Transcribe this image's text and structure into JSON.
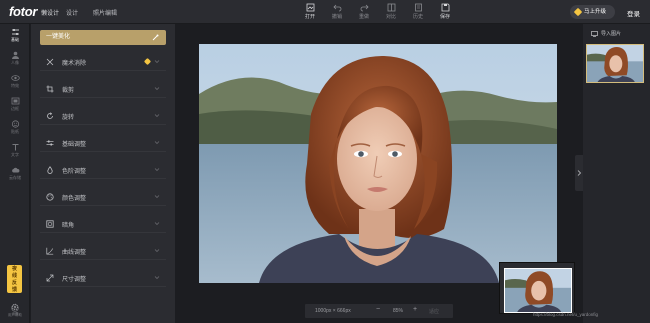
{
  "header": {
    "brand": "fotor",
    "brand_sub": "懒设计",
    "nav": [
      "设计",
      "照片编辑"
    ],
    "tools": [
      {
        "label": "打开",
        "icon": "open-file-icon",
        "active": true
      },
      {
        "label": "撤销",
        "icon": "undo-icon",
        "active": false
      },
      {
        "label": "重做",
        "icon": "redo-icon",
        "active": false
      },
      {
        "label": "对比",
        "icon": "compare-icon",
        "active": false
      },
      {
        "label": "历史",
        "icon": "history-icon",
        "active": false
      },
      {
        "label": "保存",
        "icon": "save-icon",
        "active": true
      }
    ],
    "upgrade_label": "马上升级",
    "login_label": "登录"
  },
  "rail": {
    "items": [
      {
        "label": "基础",
        "icon": "sliders-icon",
        "active": true
      },
      {
        "label": "人像",
        "icon": "person-icon",
        "active": false
      },
      {
        "label": "特效",
        "icon": "eye-icon",
        "active": false
      },
      {
        "label": "边框",
        "icon": "frame-icon",
        "active": false
      },
      {
        "label": "贴纸",
        "icon": "sticker-icon",
        "active": false
      },
      {
        "label": "文字",
        "icon": "text-icon",
        "active": false
      },
      {
        "label": "云存储",
        "icon": "cloud-icon",
        "active": false
      }
    ],
    "badge": "夜\n线\n反\n馈",
    "help_label": "用户帮助",
    "settings_label": "设置"
  },
  "panel": {
    "oneclick_label": "一键美化",
    "items": [
      {
        "label": "魔术消除",
        "icon": "eraser-icon",
        "pro": true
      },
      {
        "label": "裁剪",
        "icon": "crop-icon",
        "pro": false
      },
      {
        "label": "旋转",
        "icon": "rotate-icon",
        "pro": false
      },
      {
        "label": "基础调整",
        "icon": "adjust-icon",
        "pro": false
      },
      {
        "label": "色阶调整",
        "icon": "droplet-icon",
        "pro": false
      },
      {
        "label": "颜色调整",
        "icon": "palette-icon",
        "pro": false
      },
      {
        "label": "暗角",
        "icon": "vignette-icon",
        "pro": false
      },
      {
        "label": "曲线调整",
        "icon": "curve-icon",
        "pro": false
      },
      {
        "label": "尺寸调整",
        "icon": "resize-icon",
        "pro": false
      }
    ]
  },
  "canvas": {
    "dimensions": "1000px × 666px",
    "zoom": "85%",
    "zoom_out": "−",
    "zoom_in": "+",
    "fit_label": "适应"
  },
  "right_panel": {
    "import_label": "导入图片"
  },
  "watermark": "https://blog.csdn.net/u_yardonfig",
  "colors": {
    "accent": "#b8a06a",
    "gem": "#f4c542"
  }
}
